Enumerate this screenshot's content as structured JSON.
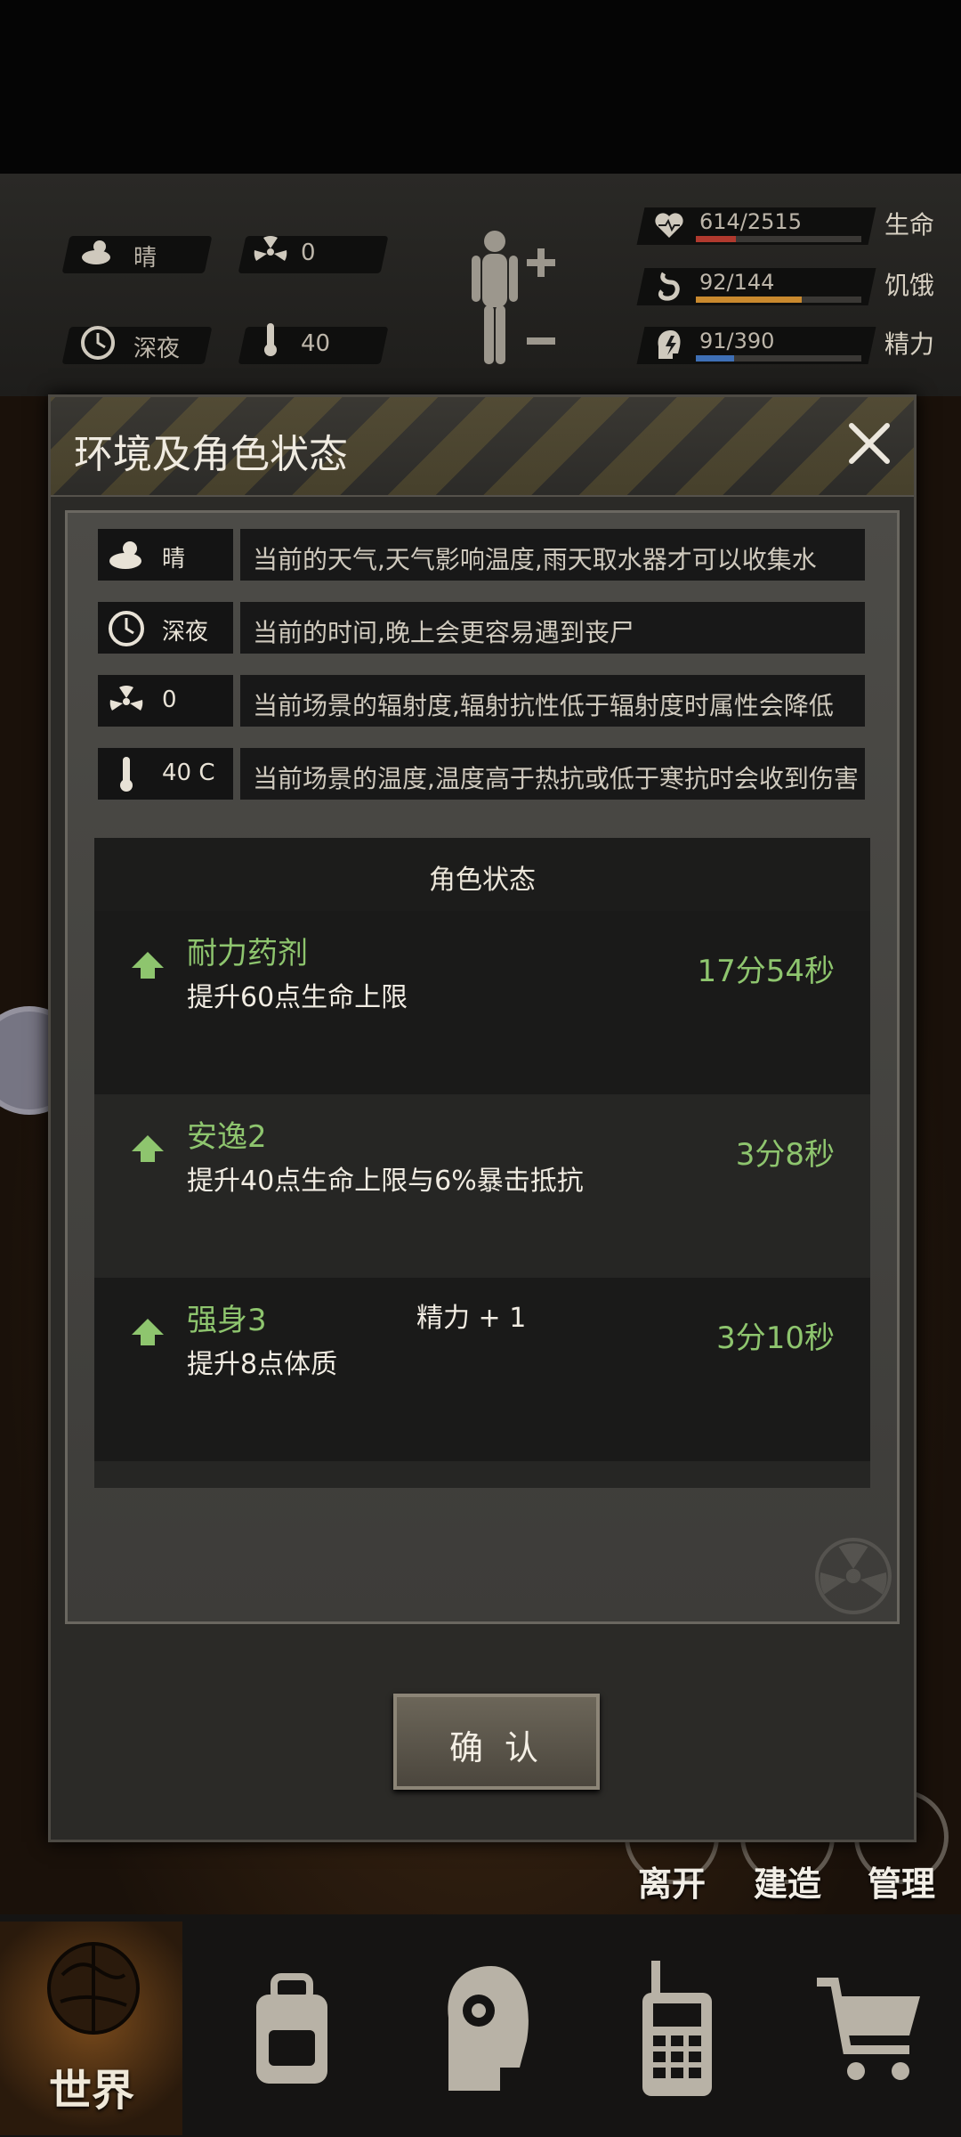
{
  "hud": {
    "weather": {
      "icon": "sun-cloud-icon",
      "label": "晴"
    },
    "radiation": {
      "icon": "radiation-icon",
      "value": "0"
    },
    "time": {
      "icon": "clock-icon",
      "label": "深夜"
    },
    "temperature": {
      "icon": "thermometer-icon",
      "value": "40"
    },
    "stats": [
      {
        "icon": "heart-pulse-icon",
        "value": "614/2515",
        "label": "生命",
        "fraction": 0.244,
        "color": "#b0392e"
      },
      {
        "icon": "stomach-icon",
        "value": "92/144",
        "label": "饥饿",
        "fraction": 0.64,
        "color": "#c9892e"
      },
      {
        "icon": "head-bolt-icon",
        "value": "91/390",
        "label": "精力",
        "fraction": 0.233,
        "color": "#3e6fb5"
      }
    ]
  },
  "dialog": {
    "title": "环境及角色状态",
    "environment": [
      {
        "icon": "sun-cloud-icon",
        "value": "晴",
        "description": "当前的天气,天气影响温度,雨天取水器才可以收集水"
      },
      {
        "icon": "clock-icon",
        "value": "深夜",
        "description": "当前的时间,晚上会更容易遇到丧尸"
      },
      {
        "icon": "radiation-icon",
        "value": "0",
        "description": "当前场景的辐射度,辐射抗性低于辐射度时属性会降低"
      },
      {
        "icon": "thermometer-icon",
        "value": "40 C",
        "description": "当前场景的温度,温度高于热抗或低于寒抗时会收到伤害"
      }
    ],
    "status_header": "角色状态",
    "buffs": [
      {
        "name": "耐力药剂",
        "description": "提升60点生命上限",
        "time": "17分54秒"
      },
      {
        "name": "安逸2",
        "description": "提升40点生命上限与6%暴击抵抗",
        "time": "3分8秒"
      },
      {
        "name": "强身3",
        "description": "提升8点体质",
        "time": "3分10秒"
      }
    ],
    "toast": "精力 + 1",
    "confirm_label": "确 认"
  },
  "side_buttons": [
    "离开",
    "建造",
    "管理"
  ],
  "bottom_nav": {
    "world_label": "世界"
  },
  "colors": {
    "buff_green": "#8ec56e",
    "panel_bg": "#2b2a27"
  }
}
